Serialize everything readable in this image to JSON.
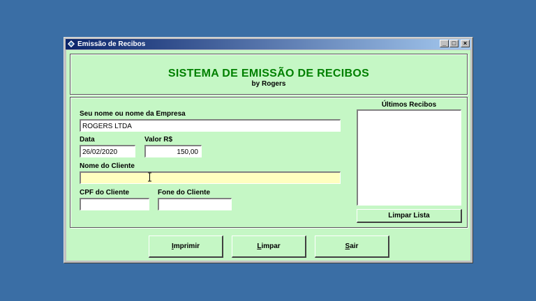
{
  "window": {
    "title": "Emissão de Recibos",
    "controls": {
      "minimize": "_",
      "maximize": "□",
      "close": "×"
    }
  },
  "header": {
    "title": "SISTEMA DE EMISSÃO DE RECIBOS",
    "subtitle": "by Rogers"
  },
  "form": {
    "company_label": "Seu nome ou nome da Empresa",
    "company_value": "ROGERS LTDA",
    "date_label": "Data",
    "date_value": "26/02/2020",
    "value_label": "Valor R$",
    "value_value": "150,00",
    "client_label": "Nome do Cliente",
    "client_value": "",
    "cpf_label": "CPF do Cliente",
    "cpf_value": "",
    "phone_label": "Fone do Cliente",
    "phone_value": ""
  },
  "receipts": {
    "label": "Últimos Recibos",
    "items": [],
    "clear_button": "Limpar Lista"
  },
  "buttons": {
    "print": {
      "accel": "I",
      "rest": "mprimir"
    },
    "clear": {
      "accel": "L",
      "rest": "impar"
    },
    "exit": {
      "accel": "S",
      "rest": "air"
    }
  },
  "colors": {
    "desktop": "#3a6ea5",
    "client_bg": "#c5f7c5",
    "title_green": "#008000",
    "active_field": "#ffffc0"
  }
}
